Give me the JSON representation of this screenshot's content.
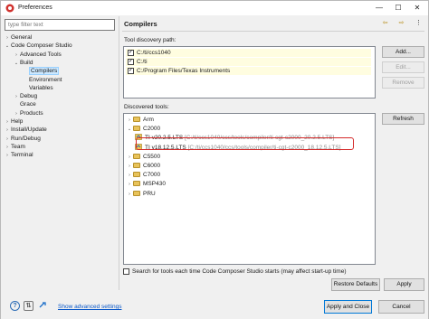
{
  "window": {
    "title": "Preferences",
    "controls": [
      "—",
      "☐",
      "✕"
    ]
  },
  "filter": {
    "placeholder": "type filter text"
  },
  "tree": [
    {
      "label": "General",
      "level": 0,
      "twisty": "›"
    },
    {
      "label": "Code Composer Studio",
      "level": 0,
      "twisty": "⌄"
    },
    {
      "label": "Advanced Tools",
      "level": 1,
      "twisty": "›"
    },
    {
      "label": "Build",
      "level": 1,
      "twisty": "⌄"
    },
    {
      "label": "Compilers",
      "level": 2,
      "twisty": "",
      "selected": true
    },
    {
      "label": "Environment",
      "level": 2,
      "twisty": ""
    },
    {
      "label": "Variables",
      "level": 2,
      "twisty": ""
    },
    {
      "label": "Debug",
      "level": 1,
      "twisty": "›"
    },
    {
      "label": "Grace",
      "level": 1,
      "twisty": ""
    },
    {
      "label": "Products",
      "level": 1,
      "twisty": "›"
    },
    {
      "label": "Help",
      "level": 0,
      "twisty": "›"
    },
    {
      "label": "Install/Update",
      "level": 0,
      "twisty": "›"
    },
    {
      "label": "Run/Debug",
      "level": 0,
      "twisty": "›"
    },
    {
      "label": "Team",
      "level": 0,
      "twisty": "›"
    },
    {
      "label": "Terminal",
      "level": 0,
      "twisty": "›"
    }
  ],
  "page": {
    "title": "Compilers",
    "nav_back": "⇦",
    "nav_fwd": "⇨",
    "menu": "⋮"
  },
  "discovery": {
    "label": "Tool discovery path:",
    "paths": [
      {
        "text": "C:/ti/ccs1040",
        "checked": true
      },
      {
        "text": "C:/ti",
        "checked": true
      },
      {
        "text": "C:/Program Files/Texas Instruments",
        "checked": true
      }
    ],
    "buttons": {
      "add": "Add...",
      "edit": "Edit...",
      "remove": "Remove"
    }
  },
  "discovered": {
    "label": "Discovered tools:",
    "refresh": "Refresh",
    "rows": [
      {
        "label": "Arm",
        "level": 0,
        "twisty": "›",
        "kind": "folder"
      },
      {
        "label": "C2000",
        "level": 0,
        "twisty": "⌄",
        "kind": "folder"
      },
      {
        "label": "TI v20.2.5.LTS",
        "path": "[C:/ti/ccs1040/ccs/tools/compiler/ti-cgt-c2000_20.2.5.LTS]",
        "level": 1,
        "kind": "tool"
      },
      {
        "label": "TI v18.12.5.LTS",
        "path": "[C:/ti/ccs1040/ccs/tools/compiler/ti-cgt-c2000_18.12.5.LTS]",
        "level": 1,
        "kind": "tool"
      },
      {
        "label": "C5500",
        "level": 0,
        "twisty": "›",
        "kind": "folder"
      },
      {
        "label": "C6000",
        "level": 0,
        "twisty": "›",
        "kind": "folder"
      },
      {
        "label": "C7000",
        "level": 0,
        "twisty": "›",
        "kind": "folder"
      },
      {
        "label": "MSP430",
        "level": 0,
        "twisty": "›",
        "kind": "folder"
      },
      {
        "label": "PRU",
        "level": 0,
        "twisty": "›",
        "kind": "folder"
      }
    ]
  },
  "search_option": {
    "label": "Search for tools each time Code Composer Studio starts (may affect start-up time)",
    "checked": false
  },
  "restore_defaults": "Restore Defaults",
  "apply": "Apply",
  "footer": {
    "show_advanced": "Show advanced settings",
    "apply_close": "Apply and Close",
    "cancel": "Cancel"
  }
}
